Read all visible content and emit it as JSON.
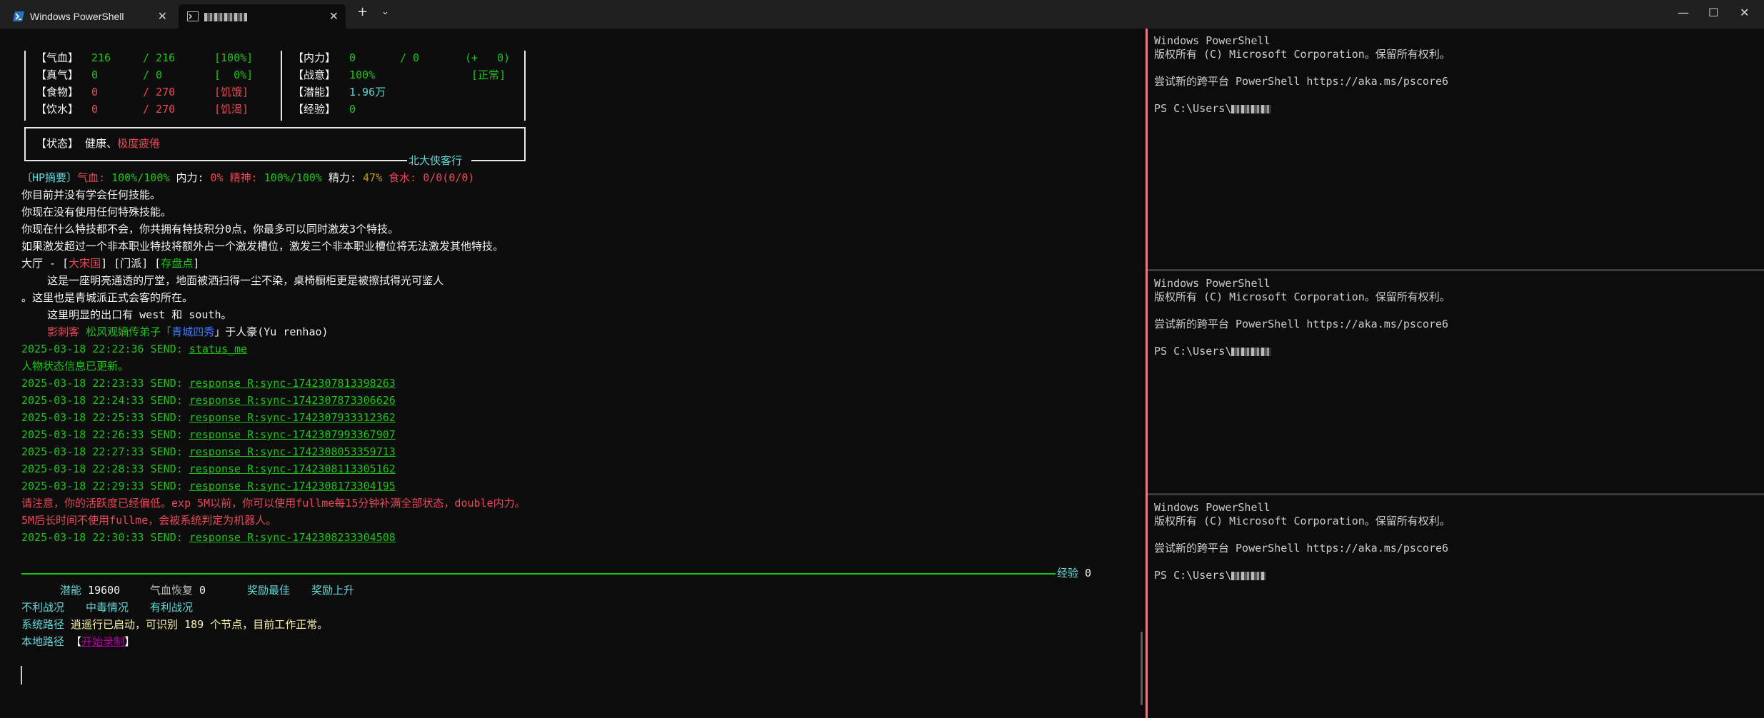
{
  "tabs": [
    {
      "label": "Windows PowerShell"
    },
    {
      "label": "ｓｖ ．"
    }
  ],
  "left": {
    "stats": {
      "qixue": {
        "label": "【气血】",
        "cur": "216",
        "max": "/ 216",
        "pct": "[100%]"
      },
      "zhenqi": {
        "label": "【真气】",
        "cur": "0",
        "max": "/ 0",
        "pct": "[  0%]"
      },
      "shiwu": {
        "label": "【食物】",
        "cur": "0",
        "max": "/ 270",
        "pct": "[饥饿]"
      },
      "yinshui": {
        "label": "【饮水】",
        "cur": "0",
        "max": "/ 270",
        "pct": "[饥渴]"
      },
      "neili": {
        "label": "【内力】",
        "cur": "0",
        "max": "/ 0",
        "pct": "(+   0)"
      },
      "zhanyi": {
        "label": "【战意】",
        "cur": "100%",
        "pct": "[正常]"
      },
      "qianneng": {
        "label": "【潜能】",
        "cur": "1.96万"
      },
      "jingyan": {
        "label": "【经验】",
        "cur": "0"
      },
      "zhuangtai": {
        "label": "【状态】",
        "v1": "健康、",
        "v2": "极度疲倦"
      },
      "footer": "北大侠客行"
    },
    "hp": {
      "tag": "〔HP摘要〕",
      "qixue_l": "气血:",
      "qixue_v": "100%/100%",
      "neili_l": "内力:",
      "neili_v": "0%",
      "jingshen_l": "精神:",
      "jingshen_v": "100%/100%",
      "jingli_l": "精力:",
      "jingli_v": "47%",
      "shishui_l": "食水:",
      "shishui_v": "0/0(0/0)"
    },
    "msgs": [
      "你目前并没有学会任何技能。",
      "你现在没有使用任何特殊技能。",
      "你现在什么特技都不会，你共拥有特技积分0点，你最多可以同时激发3个特技。",
      "如果激发超过一个非本职业特技将额外占一个激发槽位，激发三个非本职业槽位将无法激发其他特技。"
    ],
    "room": {
      "name": "大厅",
      "dash": " - [",
      "area": "大宋国",
      "mid": "] [门派] [",
      "save": "存盘点",
      "end": "]",
      "desc1": "    这是一座明亮通透的厅堂，地面被洒扫得一尘不染，桌椅橱柜更是被擦拭得光可鉴人",
      "desc2": "。这里也是青城派正式会客的所在。",
      "exits_pre": "    这里明显的出口有 ",
      "exits": "west 和 south",
      "exits_post": "。",
      "npc_pre": "    ",
      "npc_title": "影刺客",
      "npc_mid": " 松风观嫡传弟子「",
      "npc_nick": "青城四秀",
      "npc_post": "」于人豪(Yu renhao)"
    },
    "log": [
      {
        "ts": "2025-03-18 22:22:36 SEND: ",
        "cmd": "status_me"
      },
      {
        "ts": "2025-03-18 22:23:33 SEND: ",
        "cmd": "response R:sync-1742307813398263"
      },
      {
        "ts": "2025-03-18 22:24:33 SEND: ",
        "cmd": "response R:sync-1742307873306626"
      },
      {
        "ts": "2025-03-18 22:25:33 SEND: ",
        "cmd": "response R:sync-1742307933312362"
      },
      {
        "ts": "2025-03-18 22:26:33 SEND: ",
        "cmd": "response R:sync-1742307993367907"
      },
      {
        "ts": "2025-03-18 22:27:33 SEND: ",
        "cmd": "response R:sync-1742308053359713"
      },
      {
        "ts": "2025-03-18 22:28:33 SEND: ",
        "cmd": "response R:sync-1742308113305162"
      },
      {
        "ts": "2025-03-18 22:29:33 SEND: ",
        "cmd": "response R:sync-1742308173304195"
      }
    ],
    "status_updated": "人物状态信息已更新。",
    "warn1": "请注意，你的活跃度已经偏低。exp 5M以前，你可以使用fullme每15分钟补满全部状态，double内力。",
    "warn2": "5M后长时间不使用fullme，会被系统判定为机器人。",
    "last_log": {
      "ts": "2025-03-18 22:30:33 SEND: ",
      "cmd": "response R:sync-1742308233304508"
    },
    "exp_bar": {
      "label": "经验",
      "value": "0"
    },
    "bottom": {
      "qianneng_l": "潜能",
      "qianneng_v": "19600",
      "hp_regen_l": "气血恢复",
      "hp_regen_v": "0",
      "reward1": "奖励最佳",
      "reward2": "奖励上升",
      "buff1": "不利战况",
      "buff2": "中毒情况",
      "buff3": "有利战况",
      "sys_l": "系统路径",
      "sys_v": "逍遥行已启动，可识别 189 个节点，目前工作正常。",
      "local_l": "本地路径",
      "local_open": "【",
      "local_v": "开始录制",
      "local_close": "】"
    }
  },
  "ps": {
    "line1": "Windows PowerShell",
    "line2": "版权所有 (C) Microsoft Corporation。保留所有权利。",
    "line3": "尝试新的跨平台 PowerShell https://aka.ms/pscore6",
    "prompt": "PS C:\\Users\\"
  }
}
